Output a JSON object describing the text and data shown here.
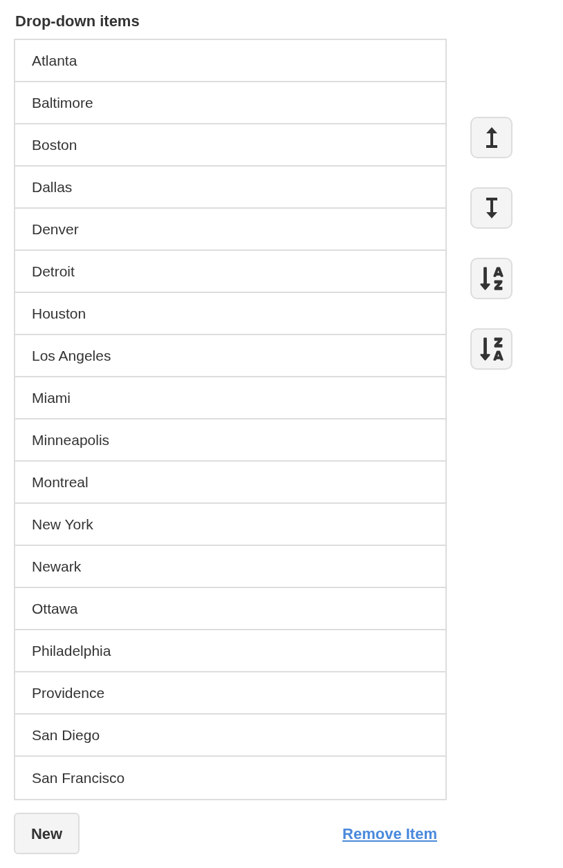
{
  "heading": "Drop-down items",
  "items": [
    {
      "label": "Atlanta"
    },
    {
      "label": "Baltimore"
    },
    {
      "label": "Boston"
    },
    {
      "label": "Dallas"
    },
    {
      "label": "Denver"
    },
    {
      "label": "Detroit"
    },
    {
      "label": "Houston"
    },
    {
      "label": "Los Angeles"
    },
    {
      "label": "Miami"
    },
    {
      "label": "Minneapolis"
    },
    {
      "label": "Montreal"
    },
    {
      "label": "New York"
    },
    {
      "label": "Newark"
    },
    {
      "label": "Ottawa"
    },
    {
      "label": "Philadelphia"
    },
    {
      "label": "Providence"
    },
    {
      "label": "San Diego"
    },
    {
      "label": "San Francisco"
    }
  ],
  "new_button": {
    "label": "New"
  },
  "remove_link": {
    "label": "Remove Item"
  }
}
